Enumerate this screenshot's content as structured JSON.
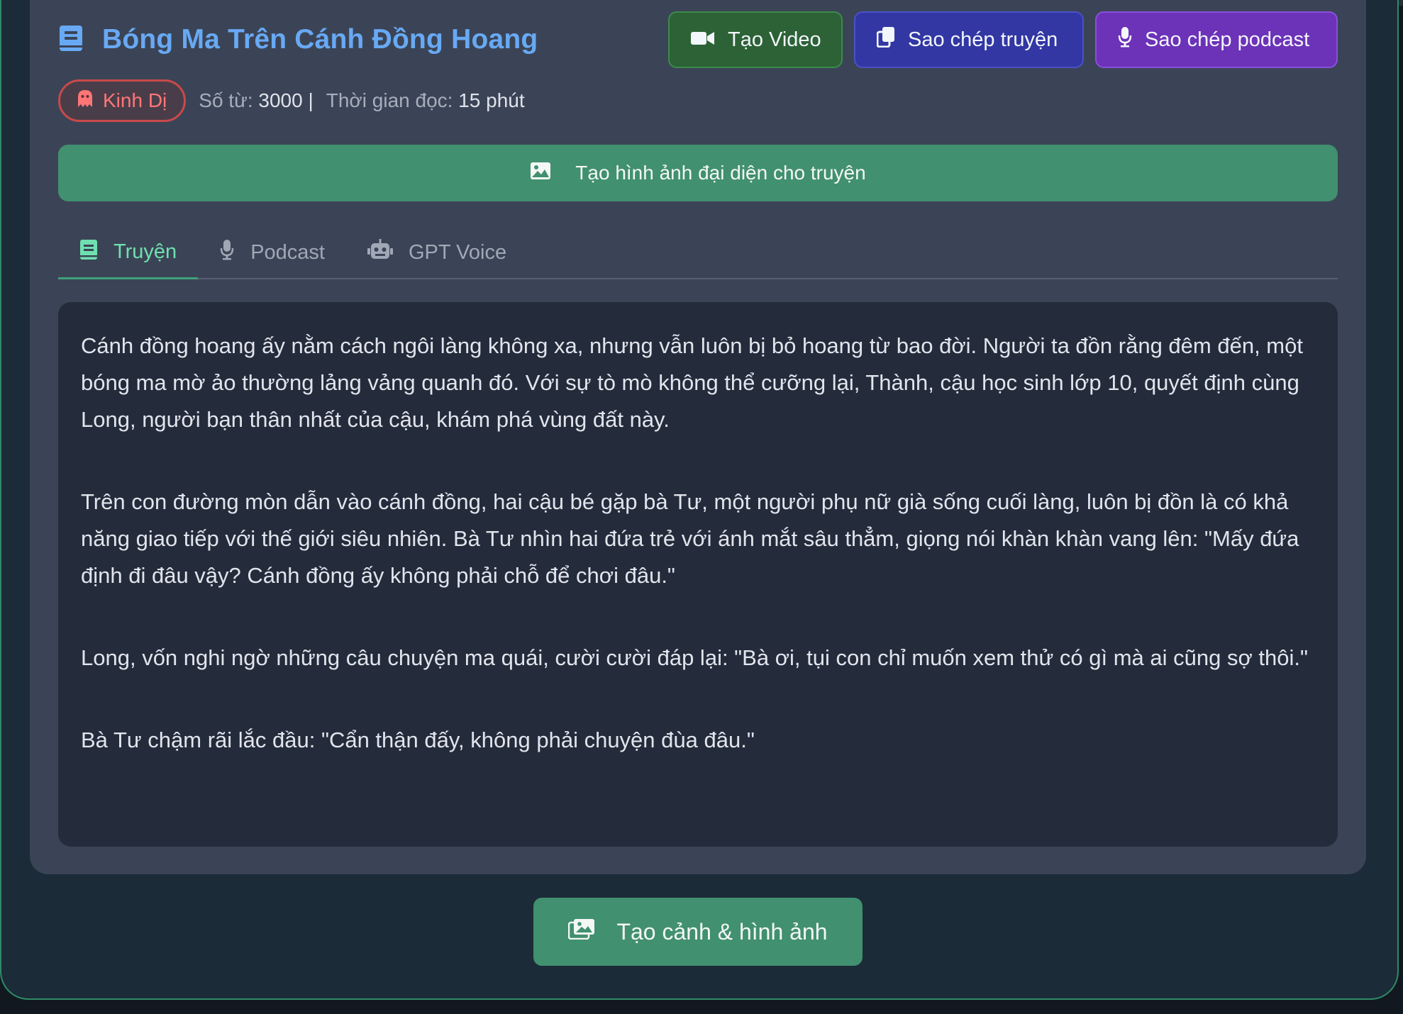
{
  "header": {
    "title": "Bóng Ma Trên Cánh Đồng Hoang",
    "title_icon": "book-icon",
    "buttons": {
      "video": "Tạo Video",
      "copy_story": "Sao chép truyện",
      "copy_podcast": "Sao chép podcast"
    }
  },
  "meta": {
    "genre": "Kinh Dị",
    "genre_icon": "ghost-icon",
    "word_count_label": "Số từ:",
    "word_count_value": "3000",
    "separator": "|",
    "read_time_label": "Thời gian đọc:",
    "read_time_value": "15 phút"
  },
  "actions": {
    "generate_cover": "Tạo hình ảnh đại diện cho truyện",
    "generate_scenes": "Tạo cảnh & hình ảnh"
  },
  "tabs": [
    {
      "label": "Truyện",
      "icon": "book-icon",
      "active": true
    },
    {
      "label": "Podcast",
      "icon": "microphone-icon",
      "active": false
    },
    {
      "label": "GPT Voice",
      "icon": "robot-icon",
      "active": false
    }
  ],
  "story": {
    "paragraphs": [
      "Cánh đồng hoang ấy nằm cách ngôi làng không xa, nhưng vẫn luôn bị bỏ hoang từ bao đời. Người ta đồn rằng đêm đến, một bóng ma mờ ảo thường lảng vảng quanh đó. Với sự tò mò không thể cưỡng lại, Thành, cậu học sinh lớp 10, quyết định cùng Long, người bạn thân nhất của cậu, khám phá vùng đất này.",
      "Trên con đường mòn dẫn vào cánh đồng, hai cậu bé gặp bà Tư, một người phụ nữ già sống cuối làng, luôn bị đồn là có khả năng giao tiếp với thế giới siêu nhiên. Bà Tư nhìn hai đứa trẻ với ánh mắt sâu thẳm, giọng nói khàn khàn vang lên: \"Mấy đứa định đi đâu vậy? Cánh đồng ấy không phải chỗ để chơi đâu.\"",
      "Long, vốn nghi ngờ những câu chuyện ma quái, cười cười đáp lại: \"Bà ơi, tụi con chỉ muốn xem thử có gì mà ai cũng sợ thôi.\"",
      "Bà Tư chậm rãi lắc đầu: \"Cẩn thận đấy, không phải chuyện đùa đâu.\""
    ]
  },
  "colors": {
    "page_bg": "#1b2b38",
    "card_bg": "#3b4456",
    "title": "#68a9f4",
    "accent_green": "#41906f",
    "video_btn": "#2c6236",
    "copy_story_btn": "#3237a4",
    "copy_podcast_btn": "#6c32b8",
    "genre_red": "#ff7676"
  }
}
